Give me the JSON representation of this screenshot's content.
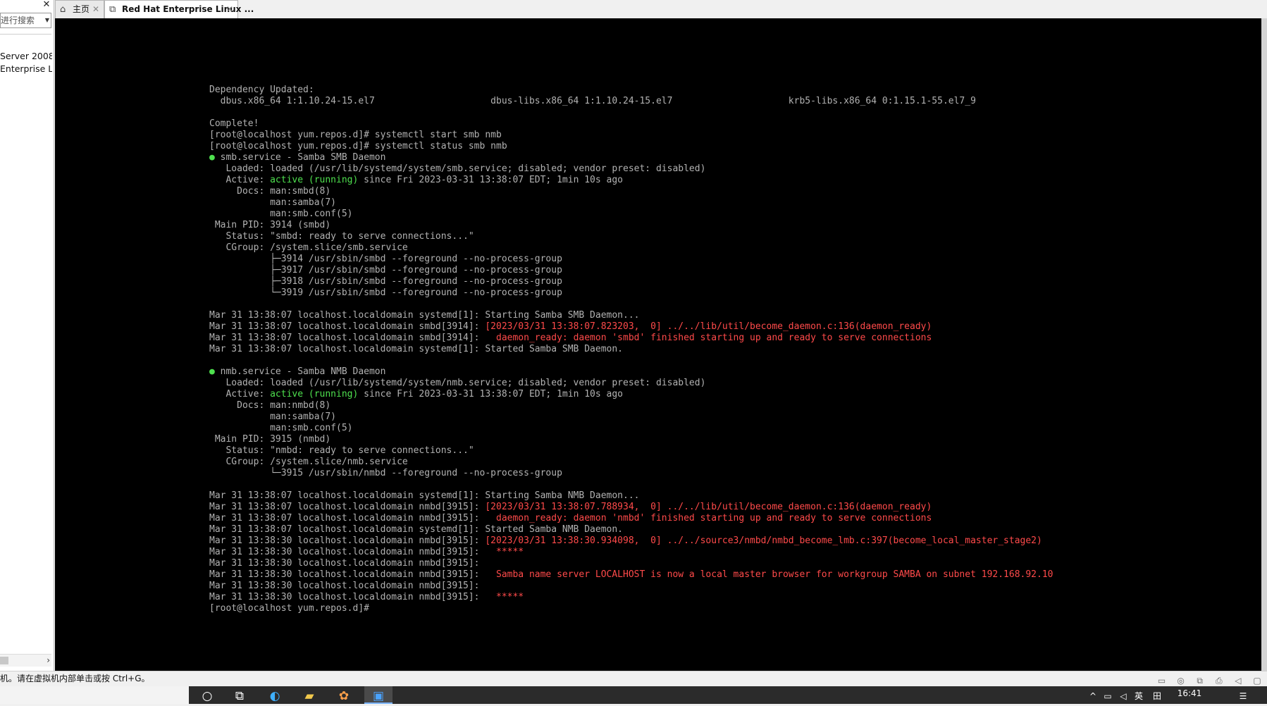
{
  "library_panel": {
    "close_glyph": "✕",
    "search_placeholder": "进行搜索",
    "items": [
      "Server 2008",
      "Enterprise Li"
    ]
  },
  "tabs": [
    {
      "label": "主页",
      "icon": "home-icon",
      "close": "✕"
    },
    {
      "label": "Red Hat Enterprise Linux ...",
      "icon": "vm-icon",
      "close": "✕"
    }
  ],
  "terminal": {
    "lines": [
      [
        {
          "t": "Dependency Updated:"
        }
      ],
      [
        {
          "t": "  dbus.x86_64 1:1.10.24-15.el7                     dbus-libs.x86_64 1:1.10.24-15.el7                     krb5-libs.x86_64 0:1.15.1-55.el7_9"
        }
      ],
      [
        {
          "t": ""
        }
      ],
      [
        {
          "t": "Complete!"
        }
      ],
      [
        {
          "t": "[root@localhost yum.repos.d]# systemctl start smb nmb"
        }
      ],
      [
        {
          "t": "[root@localhost yum.repos.d]# systemctl status smb nmb"
        }
      ],
      [
        {
          "t": "●",
          "c": "bullet"
        },
        {
          "t": " smb.service - Samba SMB Daemon"
        }
      ],
      [
        {
          "t": "   Loaded: loaded (/usr/lib/systemd/system/smb.service; disabled; vendor preset: disabled)"
        }
      ],
      [
        {
          "t": "   Active: "
        },
        {
          "t": "active (running)",
          "c": "green"
        },
        {
          "t": " since Fri 2023-03-31 13:38:07 EDT; 1min 10s ago"
        }
      ],
      [
        {
          "t": "     Docs: man:smbd(8)"
        }
      ],
      [
        {
          "t": "           man:samba(7)"
        }
      ],
      [
        {
          "t": "           man:smb.conf(5)"
        }
      ],
      [
        {
          "t": " Main PID: 3914 (smbd)"
        }
      ],
      [
        {
          "t": "   Status: \"smbd: ready to serve connections...\""
        }
      ],
      [
        {
          "t": "   CGroup: /system.slice/smb.service"
        }
      ],
      [
        {
          "t": "           ├─3914 /usr/sbin/smbd --foreground --no-process-group"
        }
      ],
      [
        {
          "t": "           ├─3917 /usr/sbin/smbd --foreground --no-process-group"
        }
      ],
      [
        {
          "t": "           ├─3918 /usr/sbin/smbd --foreground --no-process-group"
        }
      ],
      [
        {
          "t": "           └─3919 /usr/sbin/smbd --foreground --no-process-group"
        }
      ],
      [
        {
          "t": ""
        }
      ],
      [
        {
          "t": "Mar 31 13:38:07 localhost.localdomain systemd[1]: Starting Samba SMB Daemon..."
        }
      ],
      [
        {
          "t": "Mar 31 13:38:07 localhost.localdomain smbd[3914]: "
        },
        {
          "t": "[2023/03/31 13:38:07.823203,  0] ../../lib/util/become_daemon.c:136(daemon_ready)",
          "c": "red"
        }
      ],
      [
        {
          "t": "Mar 31 13:38:07 localhost.localdomain smbd[3914]: "
        },
        {
          "t": "  daemon_ready: daemon 'smbd' finished starting up and ready to serve connections",
          "c": "red"
        }
      ],
      [
        {
          "t": "Mar 31 13:38:07 localhost.localdomain systemd[1]: Started Samba SMB Daemon."
        }
      ],
      [
        {
          "t": ""
        }
      ],
      [
        {
          "t": "●",
          "c": "bullet"
        },
        {
          "t": " nmb.service - Samba NMB Daemon"
        }
      ],
      [
        {
          "t": "   Loaded: loaded (/usr/lib/systemd/system/nmb.service; disabled; vendor preset: disabled)"
        }
      ],
      [
        {
          "t": "   Active: "
        },
        {
          "t": "active (running)",
          "c": "green"
        },
        {
          "t": " since Fri 2023-03-31 13:38:07 EDT; 1min 10s ago"
        }
      ],
      [
        {
          "t": "     Docs: man:nmbd(8)"
        }
      ],
      [
        {
          "t": "           man:samba(7)"
        }
      ],
      [
        {
          "t": "           man:smb.conf(5)"
        }
      ],
      [
        {
          "t": " Main PID: 3915 (nmbd)"
        }
      ],
      [
        {
          "t": "   Status: \"nmbd: ready to serve connections...\""
        }
      ],
      [
        {
          "t": "   CGroup: /system.slice/nmb.service"
        }
      ],
      [
        {
          "t": "           └─3915 /usr/sbin/nmbd --foreground --no-process-group"
        }
      ],
      [
        {
          "t": ""
        }
      ],
      [
        {
          "t": "Mar 31 13:38:07 localhost.localdomain systemd[1]: Starting Samba NMB Daemon..."
        }
      ],
      [
        {
          "t": "Mar 31 13:38:07 localhost.localdomain nmbd[3915]: "
        },
        {
          "t": "[2023/03/31 13:38:07.788934,  0] ../../lib/util/become_daemon.c:136(daemon_ready)",
          "c": "red"
        }
      ],
      [
        {
          "t": "Mar 31 13:38:07 localhost.localdomain nmbd[3915]: "
        },
        {
          "t": "  daemon_ready: daemon 'nmbd' finished starting up and ready to serve connections",
          "c": "red"
        }
      ],
      [
        {
          "t": "Mar 31 13:38:07 localhost.localdomain systemd[1]: Started Samba NMB Daemon."
        }
      ],
      [
        {
          "t": "Mar 31 13:38:30 localhost.localdomain nmbd[3915]: "
        },
        {
          "t": "[2023/03/31 13:38:30.934098,  0] ../../source3/nmbd/nmbd_become_lmb.c:397(become_local_master_stage2)",
          "c": "red"
        }
      ],
      [
        {
          "t": "Mar 31 13:38:30 localhost.localdomain nmbd[3915]: "
        },
        {
          "t": "  *****",
          "c": "red"
        }
      ],
      [
        {
          "t": "Mar 31 13:38:30 localhost.localdomain nmbd[3915]:"
        }
      ],
      [
        {
          "t": "Mar 31 13:38:30 localhost.localdomain nmbd[3915]: "
        },
        {
          "t": "  Samba name server LOCALHOST is now a local master browser for workgroup SAMBA on subnet 192.168.92.10",
          "c": "red"
        }
      ],
      [
        {
          "t": "Mar 31 13:38:30 localhost.localdomain nmbd[3915]:"
        }
      ],
      [
        {
          "t": "Mar 31 13:38:30 localhost.localdomain nmbd[3915]: "
        },
        {
          "t": "  *****",
          "c": "red"
        }
      ],
      [
        {
          "t": "[root@localhost yum.repos.d]#"
        }
      ]
    ]
  },
  "statusbar": {
    "hint": "机。请在虚拟机内部单击或按 Ctrl+G。",
    "device_icons": [
      "hard-disk-icon",
      "cd-rom-icon",
      "network-adapter-icon",
      "printer-icon",
      "sound-card-icon",
      "message-icon"
    ]
  },
  "taskbar": {
    "buttons": [
      {
        "name": "search-icon",
        "glyph": "○"
      },
      {
        "name": "task-view-icon",
        "glyph": "⧉"
      },
      {
        "name": "edge-browser-icon",
        "glyph": "◐"
      },
      {
        "name": "file-explorer-icon",
        "glyph": "▰"
      },
      {
        "name": "app-flower-icon",
        "glyph": "✿"
      },
      {
        "name": "vmware-icon",
        "glyph": "▣"
      }
    ],
    "tray": {
      "chevron": "^",
      "ime": "英",
      "ime_mode": "田",
      "time": "16:41"
    }
  },
  "colors": {
    "terminal_bg": "#000000",
    "terminal_fg": "#b2b2b2",
    "terminal_green": "#4ee04e",
    "terminal_red": "#ff4a4a",
    "taskbar": "#2b2b2b"
  }
}
